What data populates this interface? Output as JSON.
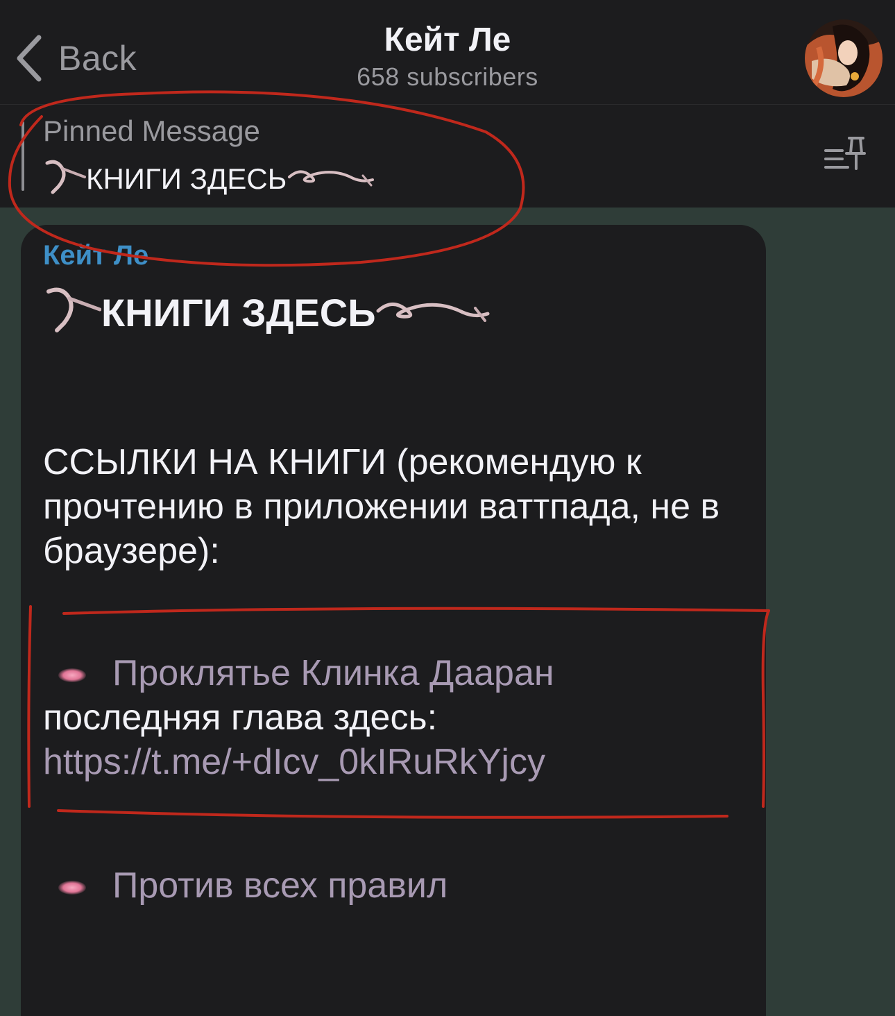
{
  "header": {
    "back_label": "Back",
    "title": "Кейт Ле",
    "subscribers": "658 subscribers"
  },
  "pinned": {
    "label": "Pinned Message",
    "text": "КНИГИ ЗДЕСЬ"
  },
  "message": {
    "sender": "Кейт Ле",
    "heading": "КНИГИ ЗДЕСЬ",
    "intro": "ССЫЛКИ НА КНИГИ (рекомендую к прочтению в приложении ваттпада, не в браузере):",
    "books": [
      {
        "title": "Проклятье Клинка Дааран",
        "note": "последняя глава здесь:",
        "link": "https://t.me/+dIcv_0kIRuRkYjcy"
      },
      {
        "title": "Против всех правил"
      }
    ]
  },
  "colors": {
    "header_bg": "#1c1c1e",
    "chat_bg": "#2f3d38",
    "sender": "#3e8fc7",
    "link": "#a89ab3",
    "annotation": "#c0281c"
  }
}
